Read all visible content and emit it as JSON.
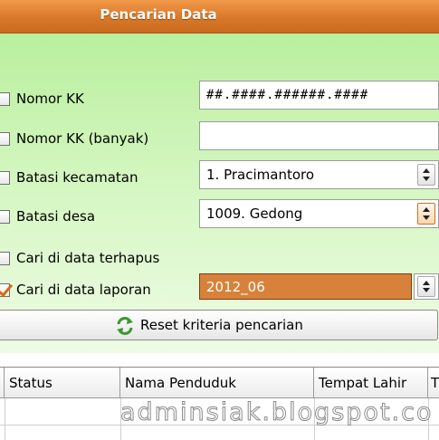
{
  "window": {
    "title": "Pencarian Data"
  },
  "filters": {
    "nomor_kk": {
      "label": "Nomor KK",
      "checked": false,
      "value": "##.####.######.####"
    },
    "nomor_kk_banyak": {
      "label": "Nomor KK (banyak)",
      "checked": false,
      "value": ""
    },
    "batasi_kecamatan": {
      "label": "Batasi kecamatan",
      "checked": false,
      "value": "1. Pracimantoro"
    },
    "batasi_desa": {
      "label": "Batasi desa",
      "checked": false,
      "value": "1009. Gedong"
    },
    "cari_terhapus": {
      "label": "Cari di data terhapus",
      "checked": false
    },
    "cari_laporan": {
      "label": "Cari di data laporan",
      "checked": true,
      "value": "2012_06"
    }
  },
  "reset_button": {
    "label": "Reset kriteria pencarian",
    "icon": "refresh-icon"
  },
  "table": {
    "columns": [
      "Status",
      "Nama Penduduk",
      "Tempat Lahir",
      "T"
    ]
  },
  "watermark": "adminsiak.blogspot.co",
  "colors": {
    "title_orange": "#d9782a",
    "panel_green": "#c6f2ad",
    "selected_orange": "#d8813a"
  }
}
